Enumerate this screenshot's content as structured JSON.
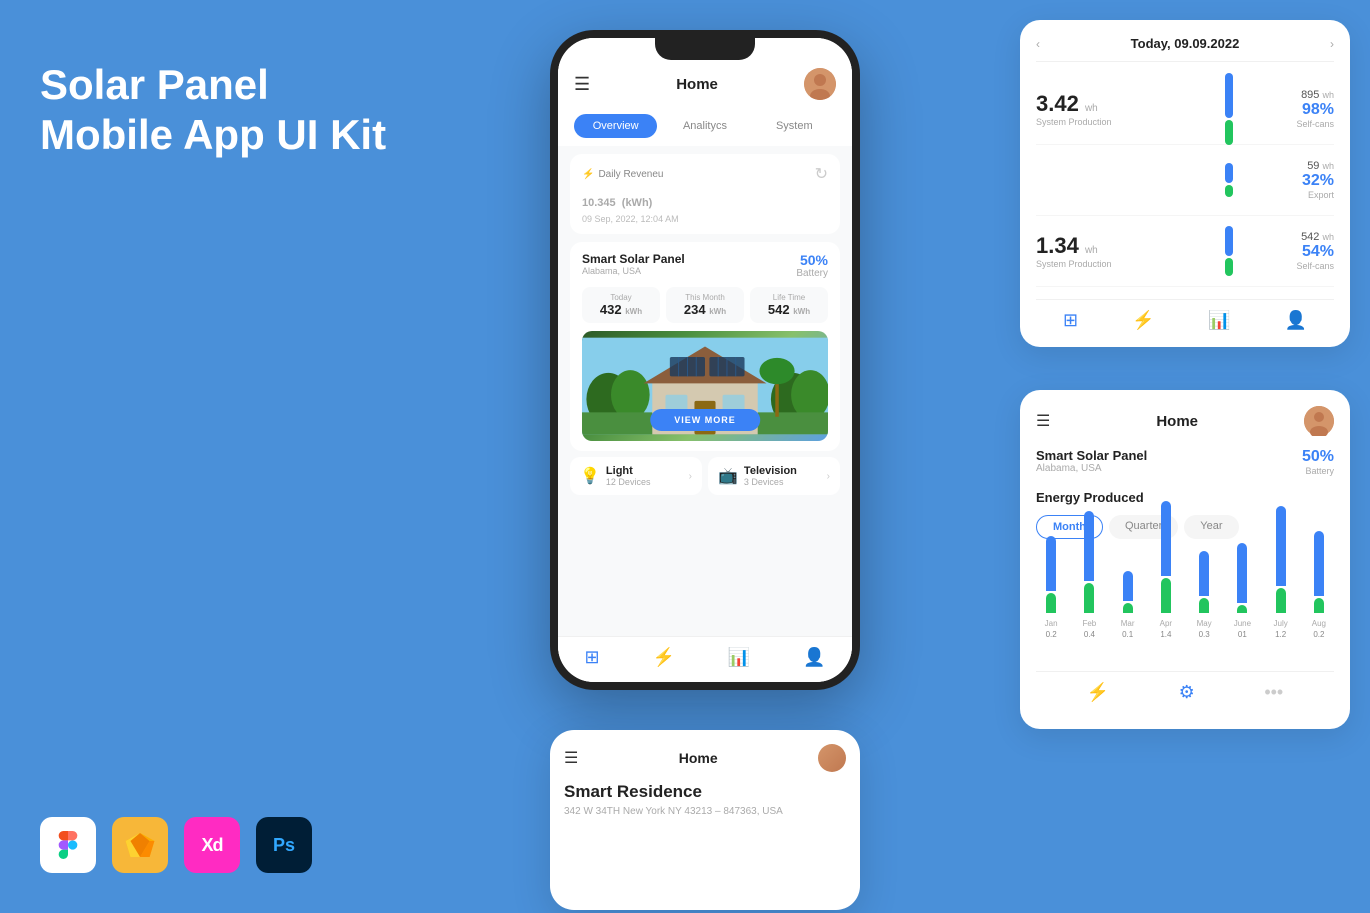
{
  "title": {
    "line1": "Solar Panel",
    "line2": "Mobile App UI Kit"
  },
  "tools": [
    {
      "name": "figma",
      "label": "F",
      "color": "#ffffff"
    },
    {
      "name": "sketch",
      "label": "S",
      "color": "#f7b739"
    },
    {
      "name": "xd",
      "label": "Xd",
      "color": "#ff2bc2"
    },
    {
      "name": "ps",
      "label": "Ps",
      "color": "#001e36"
    }
  ],
  "phone": {
    "header": {
      "title": "Home"
    },
    "tabs": [
      "Overview",
      "Analitycs",
      "System"
    ],
    "revenue": {
      "label": "Daily Reveneu",
      "amount": "10.345",
      "unit": "(kWh)",
      "date": "09 Sep, 2022, 12:04 AM"
    },
    "solar": {
      "title": "Smart Solar Panel",
      "location": "Alabama, USA",
      "battery_pct": "50%",
      "battery_label": "Battery",
      "stats": [
        {
          "label": "Today",
          "value": "432",
          "unit": "kWh"
        },
        {
          "label": "This Month",
          "value": "234",
          "unit": "kWh"
        },
        {
          "label": "Life Time",
          "value": "542",
          "unit": "kWh"
        }
      ]
    },
    "view_more": "VIEW MORE",
    "devices": [
      {
        "icon": "💡",
        "name": "Light",
        "count": "12 Devices"
      },
      {
        "icon": "📺",
        "name": "Television",
        "count": "3 Devices"
      }
    ]
  },
  "analytics": {
    "date": "Today, 09.09.2022",
    "rows": [
      {
        "value": "3.42",
        "unit": "wh",
        "label": "System Production",
        "kwh": "895",
        "kwh_unit": "wh",
        "pct": "98%",
        "sub_label": "Self-cans",
        "bar_blue": 45,
        "bar_green": 30
      },
      {
        "value": "",
        "unit": "",
        "label": "",
        "kwh": "59",
        "kwh_unit": "wh",
        "pct": "32%",
        "sub_label": "Export",
        "bar_blue": 20,
        "bar_green": 12
      },
      {
        "value": "1.34",
        "unit": "wh",
        "label": "System Production",
        "kwh": "542",
        "kwh_unit": "wh",
        "pct": "54%",
        "sub_label": "Self-cans",
        "bar_blue": 30,
        "bar_green": 18
      }
    ]
  },
  "home_panel": {
    "title": "Home",
    "solar_title": "Smart Solar Panel",
    "solar_location": "Alabama, USA",
    "battery_pct": "50%",
    "battery_label": "Battery",
    "energy_title": "Energy Produced",
    "energy_tabs": [
      "Month",
      "Quarter",
      "Year"
    ],
    "chart": {
      "months": [
        "Jan",
        "Feb",
        "Mar",
        "Apr",
        "May",
        "June",
        "July",
        "Aug"
      ],
      "blue_bars": [
        55,
        70,
        30,
        90,
        45,
        60,
        80,
        65
      ],
      "green_bars": [
        20,
        30,
        10,
        35,
        15,
        8,
        25,
        15
      ],
      "values": [
        "0.2",
        "0.4",
        "0.1",
        "1.4",
        "0.3",
        "01",
        "1.2",
        "0.2"
      ]
    }
  },
  "bottom_phone": {
    "title": "Home",
    "residence_title": "Smart Residence",
    "address": "342 W 34TH New York NY 43213 – 847363, USA"
  }
}
